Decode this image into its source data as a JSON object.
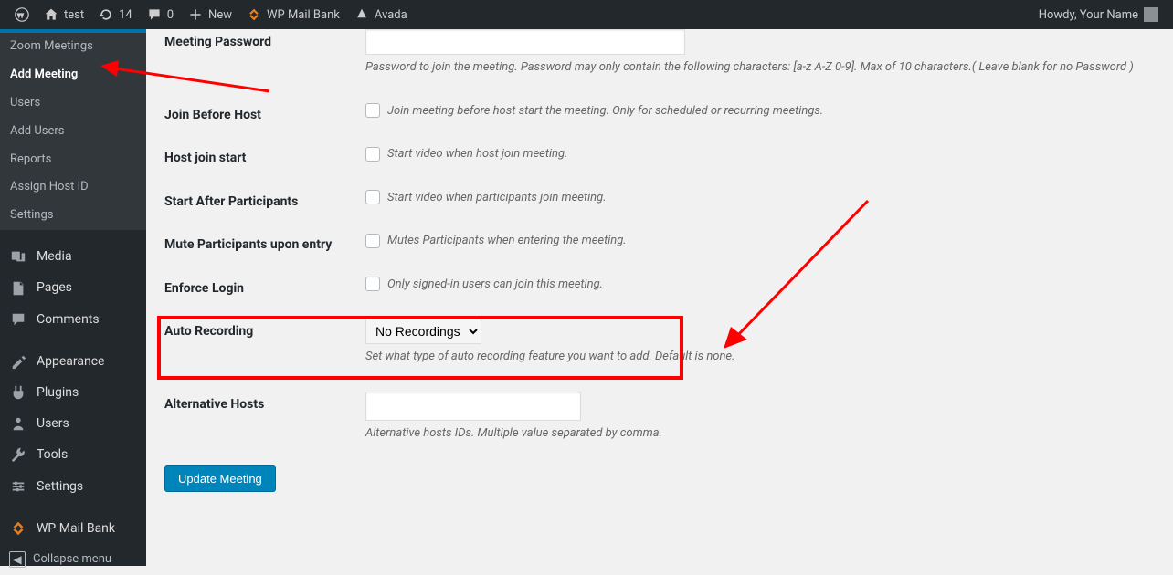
{
  "adminbar": {
    "site_title": "test",
    "updates_count": "14",
    "comments_count": "0",
    "new_label": "New",
    "wp_mail_bank": "WP Mail Bank",
    "avada": "Avada",
    "howdy": "Howdy, Your Name"
  },
  "sidebar": {
    "submenu": {
      "zoom_meetings": "Zoom Meetings",
      "add_meeting": "Add Meeting",
      "users": "Users",
      "add_users": "Add Users",
      "reports": "Reports",
      "assign_host": "Assign Host ID",
      "settings": "Settings"
    },
    "menu": {
      "media": "Media",
      "pages": "Pages",
      "comments": "Comments",
      "appearance": "Appearance",
      "plugins": "Plugins",
      "users": "Users",
      "tools": "Tools",
      "settings": "Settings",
      "wp_mail_bank": "WP Mail Bank",
      "collapse": "Collapse menu"
    }
  },
  "form": {
    "meeting_password": {
      "label": "Meeting Password",
      "desc": "Password to join the meeting. Password may only contain the following characters: [a-z A-Z 0-9]. Max of 10 characters.( Leave blank for no Password )"
    },
    "join_before": {
      "label": "Join Before Host",
      "desc": "Join meeting before host start the meeting. Only for scheduled or recurring meetings."
    },
    "host_join": {
      "label": "Host join start",
      "desc": "Start video when host join meeting."
    },
    "start_after": {
      "label": "Start After Participants",
      "desc": "Start video when participants join meeting."
    },
    "mute": {
      "label": "Mute Participants upon entry",
      "desc": "Mutes Participants when entering the meeting."
    },
    "enforce_login": {
      "label": "Enforce Login",
      "desc": "Only signed-in users can join this meeting."
    },
    "auto_recording": {
      "label": "Auto Recording",
      "option": "No Recordings",
      "desc": "Set what type of auto recording feature you want to add. Default is none."
    },
    "alt_hosts": {
      "label": "Alternative Hosts",
      "desc": "Alternative hosts IDs. Multiple value separated by comma."
    },
    "submit": "Update Meeting"
  }
}
